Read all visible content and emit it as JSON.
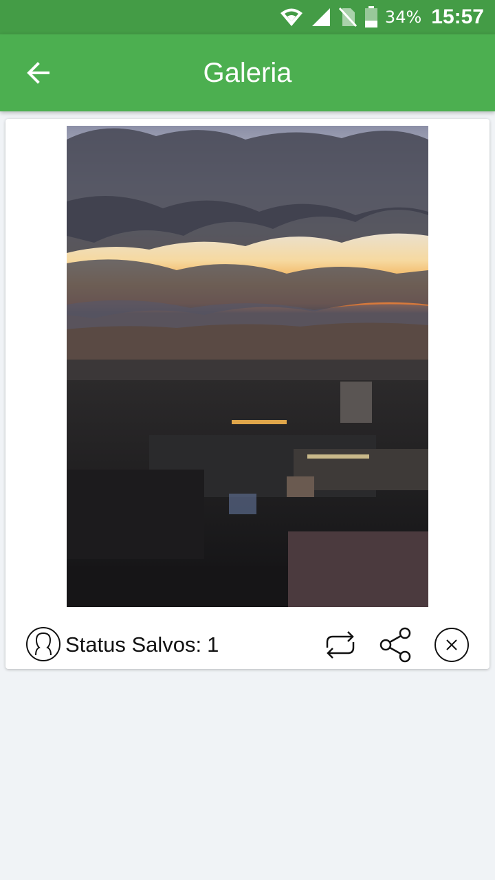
{
  "status_bar": {
    "battery_percent": "34%",
    "time": "15:57",
    "icons": [
      "wifi-icon",
      "signal-icon",
      "no-sim-icon",
      "battery-icon"
    ]
  },
  "app_bar": {
    "title": "Galeria",
    "back_icon": "arrow-left-icon",
    "background": "#4caf50",
    "status_bar_background": "#449c46"
  },
  "card": {
    "image_alt": "sunset-city-skyline-photo",
    "footer": {
      "avatar_icon": "person-icon",
      "label": "Status Salvos:",
      "count": "1",
      "actions": [
        "repost-icon",
        "share-icon",
        "close-circle-icon"
      ]
    }
  }
}
